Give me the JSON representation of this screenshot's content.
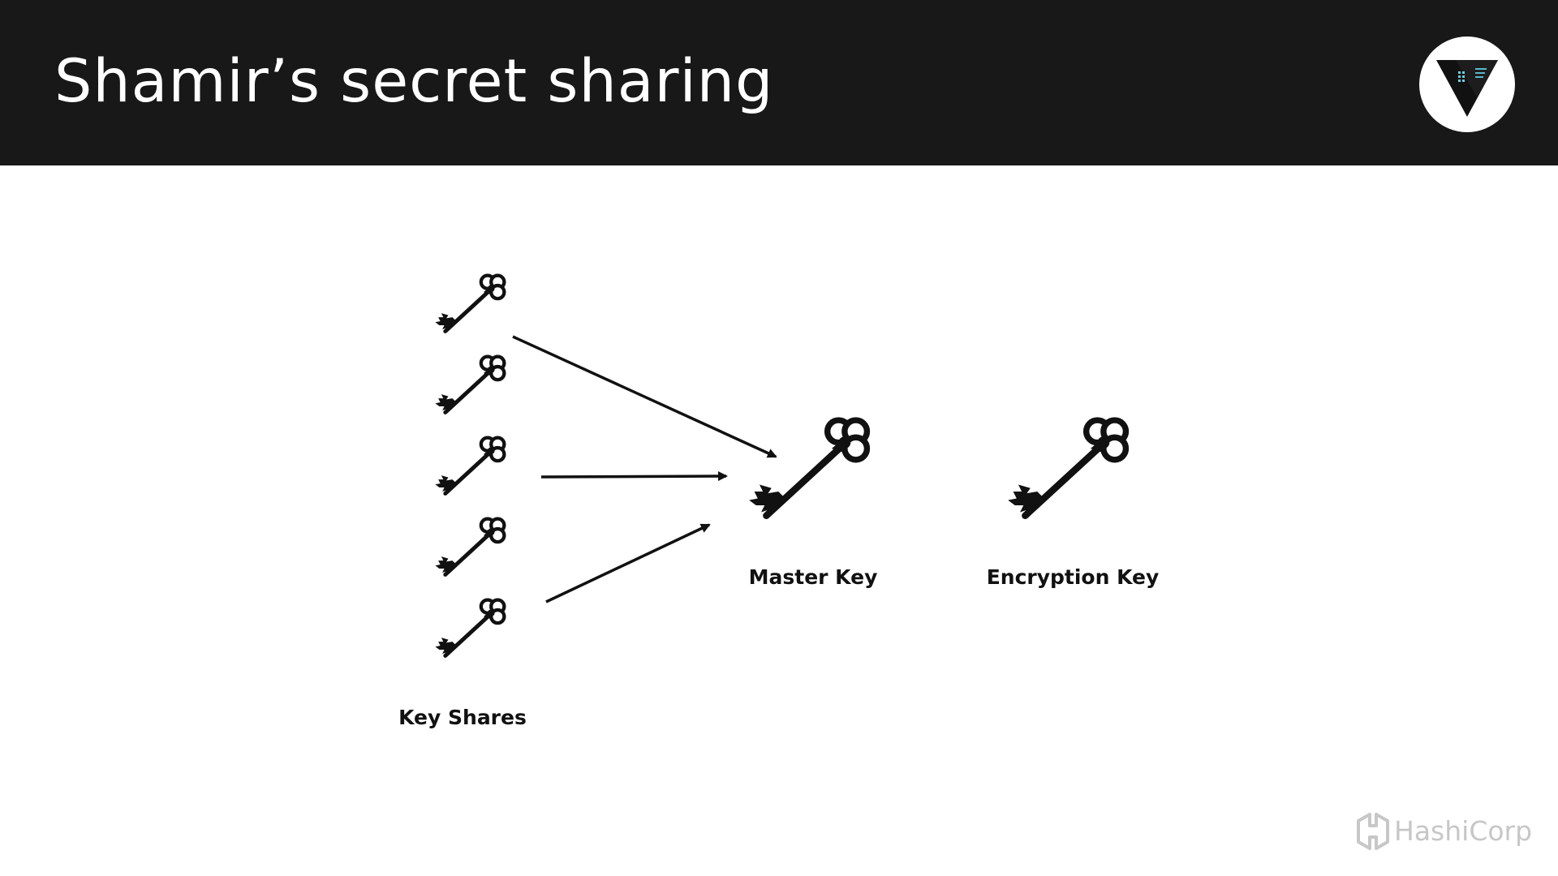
{
  "slide": {
    "title": "Shamir’s secret sharing"
  },
  "header": {
    "background": "#181818",
    "logo_icon": "vault-logo-icon"
  },
  "diagram": {
    "key_icon": "key-icon",
    "key_shares": {
      "label": "Key Shares",
      "count": 5
    },
    "master_key": {
      "label": "Master Key"
    },
    "encryption_key": {
      "label": "Encryption Key"
    },
    "arrows_into_master_key": 3
  },
  "footer": {
    "brand_name": "HashiCorp",
    "brand_icon": "hashicorp-logo-icon",
    "brand_color": "#c7c7c7"
  }
}
